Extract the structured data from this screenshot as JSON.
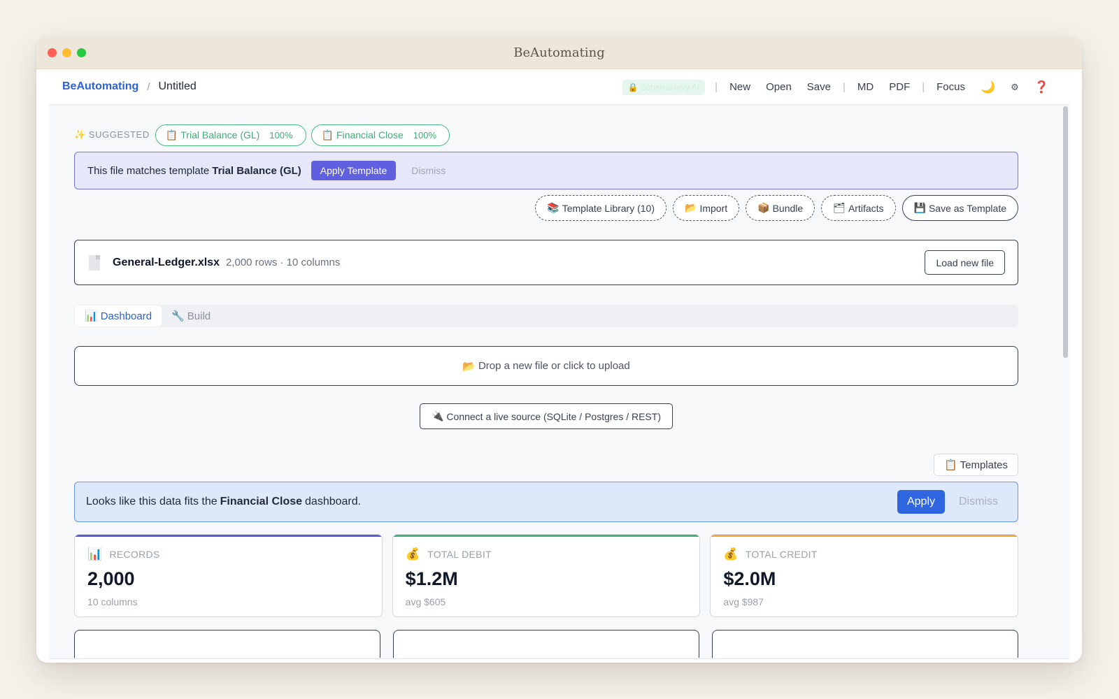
{
  "window": {
    "title": "BeAutomating"
  },
  "appbar": {
    "brand": "BeAutomating",
    "separator": "/",
    "document": "Untitled",
    "schema_pill": "🔒 Schema-only AI",
    "nav": {
      "new": "New",
      "open": "Open",
      "save": "Save",
      "md": "MD",
      "pdf": "PDF",
      "focus": "Focus"
    },
    "icons": {
      "theme": "moon-icon",
      "settings": "gear-icon",
      "help": "help-icon"
    },
    "icon_glyphs": {
      "theme": "🌙",
      "settings": "⚙",
      "help": "❓"
    }
  },
  "suggested": {
    "label": "SUGGESTED",
    "spark": "✨",
    "chips": [
      {
        "icon": "📋",
        "label": "Trial Balance (GL)",
        "pct": "100%"
      },
      {
        "icon": "📋",
        "label": "Financial Close",
        "pct": "100%"
      }
    ]
  },
  "template_match": {
    "prefix": "This file matches template",
    "template": "Trial Balance (GL)",
    "apply": "Apply Template",
    "dismiss": "Dismiss"
  },
  "library_actions": [
    {
      "icon": "📚",
      "label": "Template Library (10)"
    },
    {
      "icon": "📂",
      "label": "Import"
    },
    {
      "icon": "📦",
      "label": "Bundle"
    },
    {
      "icon": "🗂",
      "label": "Artifacts"
    }
  ],
  "save_as_template": {
    "icon": "💾",
    "label": "Save as Template"
  },
  "file": {
    "name": "General-Ledger.xlsx",
    "meta": "2,000 rows · 10 columns",
    "load_new": "Load new file"
  },
  "tabs": [
    {
      "icon": "📊",
      "label": "Dashboard",
      "active": true
    },
    {
      "icon": "🔧",
      "label": "Build",
      "active": false
    }
  ],
  "drop_zone": {
    "icon": "📂",
    "label": "Drop a new file or click to upload"
  },
  "connect": {
    "icon": "🔌",
    "label": "Connect a live source (SQLite / Postgres / REST)"
  },
  "templates_btn": {
    "icon": "📋",
    "label": "Templates"
  },
  "fit_banner": {
    "prefix": "Looks like this data fits the",
    "dashboard": "Financial Close",
    "suffix": "dashboard.",
    "apply": "Apply",
    "dismiss": "Dismiss"
  },
  "kpis": [
    {
      "icon": "📊",
      "label": "RECORDS",
      "value": "2,000",
      "sub": "10 columns",
      "accent": "#5b5bd6"
    },
    {
      "icon": "💰",
      "label": "TOTAL DEBIT",
      "value": "$1.2M",
      "sub": "avg $605",
      "accent": "#3fb37f"
    },
    {
      "icon": "💰",
      "label": "TOTAL CREDIT",
      "value": "$2.0M",
      "sub": "avg $987",
      "accent": "#f0a83a"
    }
  ],
  "colors": {
    "brand": "#2f62d8",
    "suggest_green": "#3cae76",
    "template_purple": "#5f5fe0",
    "apply_blue": "#2f66e0"
  }
}
